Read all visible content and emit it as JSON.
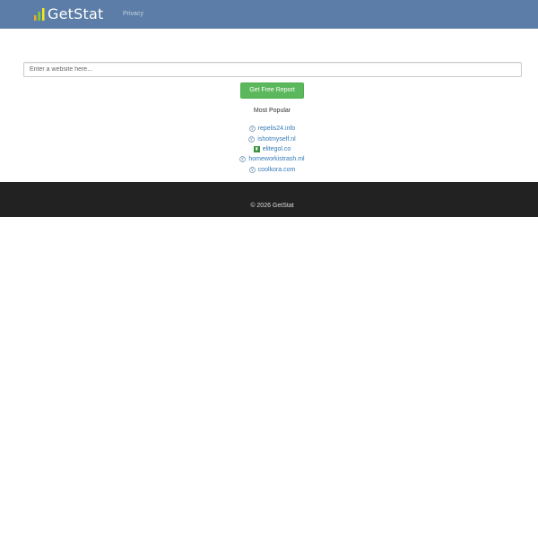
{
  "navbar": {
    "brand": "GetStat",
    "brand_icon": "bar-chart-icon",
    "links": [
      {
        "label": "Privacy"
      }
    ],
    "background": "#5b7da7"
  },
  "search": {
    "placeholder": "Enter a website here...",
    "value": ""
  },
  "report_button": {
    "label": "Get Free Report",
    "color": "#5cb85c"
  },
  "popular": {
    "heading": "Most Popular",
    "sites": [
      {
        "domain": "repelis24.info",
        "icon": "globe-icon"
      },
      {
        "domain": "ishotmyself.nl",
        "icon": "globe-icon"
      },
      {
        "domain": "elitegol.co",
        "icon": "site-favicon-icon"
      },
      {
        "domain": "homeworkistrash.ml",
        "icon": "globe-icon"
      },
      {
        "domain": "coolkora.com",
        "icon": "globe-icon"
      }
    ]
  },
  "footer": {
    "text": "© 2026 GetStat",
    "background": "#222222"
  }
}
